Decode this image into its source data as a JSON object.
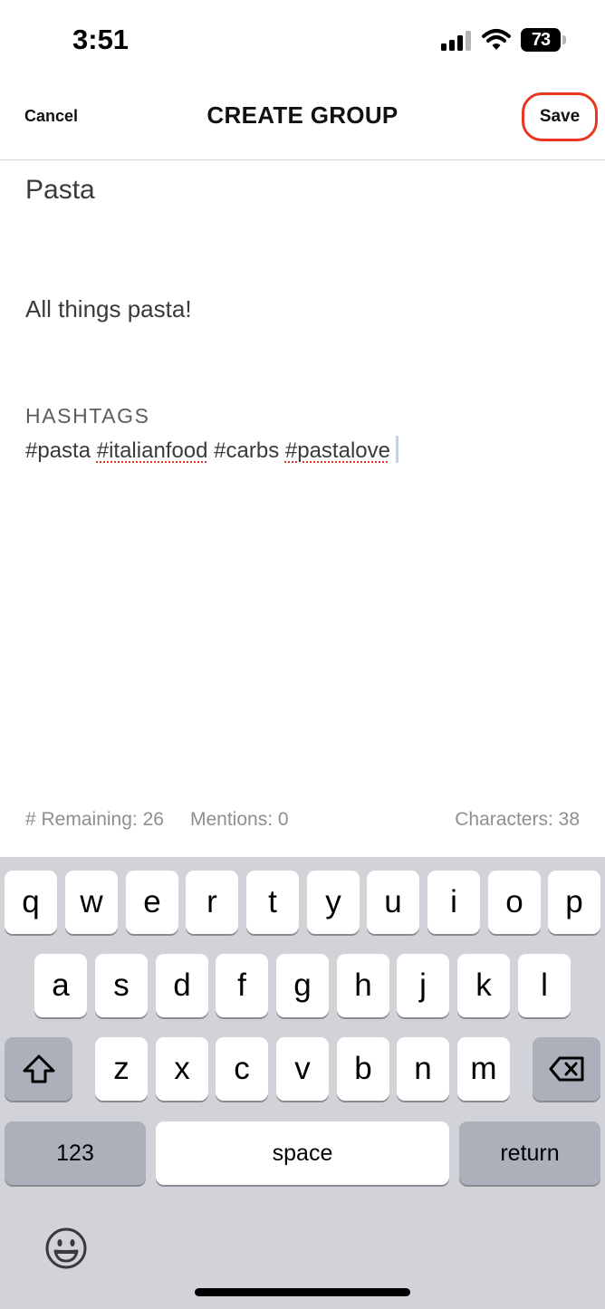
{
  "status_bar": {
    "time": "3:51",
    "battery_level": "73",
    "icons": [
      "signal-icon",
      "wifi-icon",
      "battery-icon"
    ]
  },
  "nav": {
    "cancel_label": "Cancel",
    "title": "CREATE GROUP",
    "save_label": "Save",
    "save_highlight_color": "#e8361f"
  },
  "form": {
    "group_name": "Pasta",
    "description": "All things pasta!",
    "hashtags_label": "HASHTAGS",
    "hashtags": [
      {
        "text": "#pasta",
        "misspelled": false
      },
      {
        "text": "#italianfood",
        "misspelled": true
      },
      {
        "text": "#carbs",
        "misspelled": false
      },
      {
        "text": "#pastalove",
        "misspelled": true
      }
    ]
  },
  "counters": {
    "remaining": "# Remaining: 26",
    "mentions": "Mentions: 0",
    "characters": "Characters: 38"
  },
  "keyboard": {
    "row1": [
      "q",
      "w",
      "e",
      "r",
      "t",
      "y",
      "u",
      "i",
      "o",
      "p"
    ],
    "row2": [
      "a",
      "s",
      "d",
      "f",
      "g",
      "h",
      "j",
      "k",
      "l"
    ],
    "row3": [
      "z",
      "x",
      "c",
      "v",
      "b",
      "n",
      "m"
    ],
    "numbers_label": "123",
    "space_label": "space",
    "return_label": "return",
    "icons": [
      "shift-icon",
      "backspace-icon",
      "emoji-icon"
    ]
  }
}
